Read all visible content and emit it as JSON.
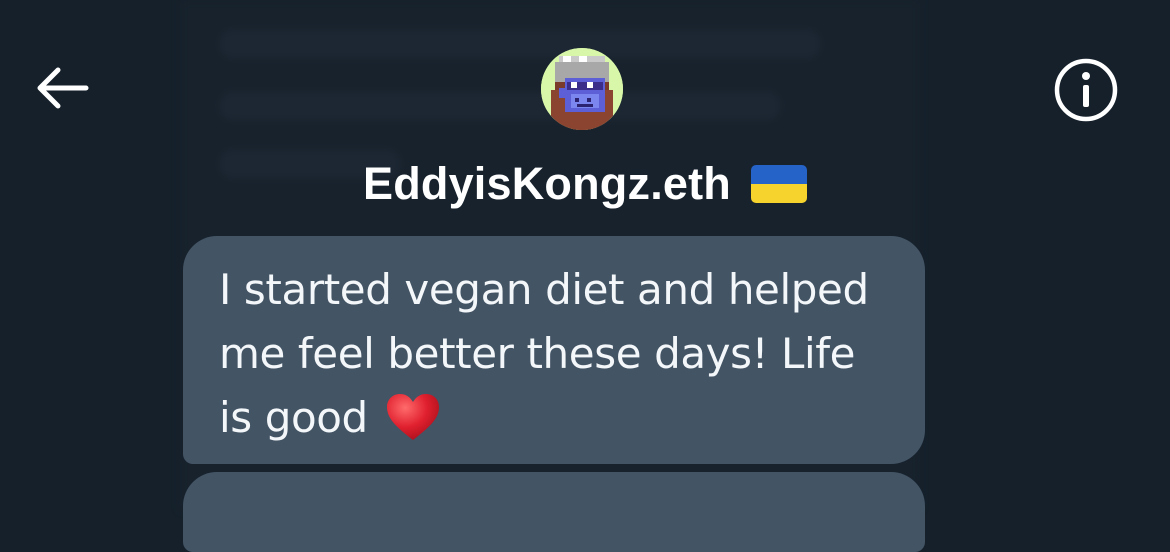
{
  "header": {
    "name": "EddyisKongz.eth",
    "flag_icon": "ukraine-flag-icon",
    "back_icon": "arrow-left-icon",
    "info_icon": "info-icon"
  },
  "messages": [
    {
      "text": "I started vegan diet and helped me feel better these days! Life is good",
      "emoji": "red-heart-icon"
    }
  ],
  "colors": {
    "background": "#15202b",
    "bubble": "#435465",
    "text": "#ffffff",
    "heart": "#e0202e",
    "flag_blue": "#2563c8",
    "flag_yellow": "#f7d32e"
  }
}
